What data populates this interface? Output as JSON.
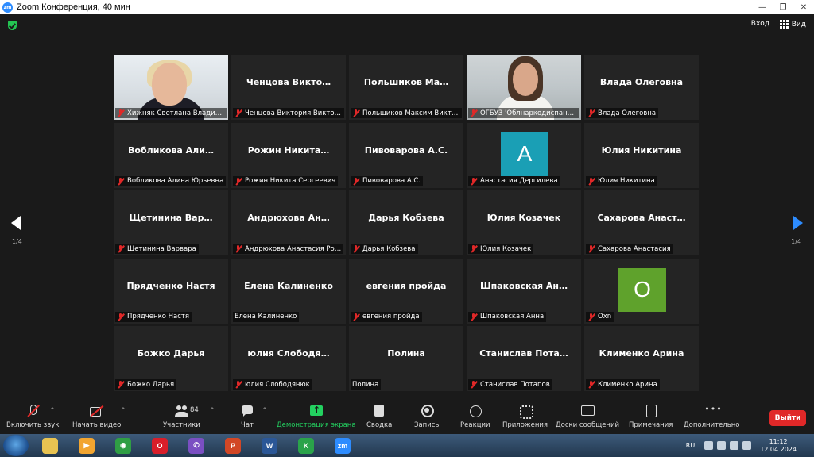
{
  "window": {
    "title": "Zoom Конференция, 40 мин",
    "app_icon": "zm"
  },
  "topbar": {
    "enter_label": "Вход",
    "view_label": "Вид"
  },
  "pagination": {
    "left": "1/4",
    "right": "1/4"
  },
  "tiles": [
    {
      "big": "",
      "label": "Хижняк Светлана Владими…",
      "video": 1,
      "muted": true
    },
    {
      "big": "Ченцова Виктo…",
      "label": "Ченцова Виктория Виктор…",
      "muted": true
    },
    {
      "big": "Польшиков Ма…",
      "label": "Польшиков Максим Викто…",
      "muted": true
    },
    {
      "big": "",
      "label": "ОГБУЗ 'Облнаркодиспансер'…",
      "video": 2,
      "muted": true,
      "active": true
    },
    {
      "big": "Влада Олеговна",
      "label": "Влада Олеговна",
      "muted": true
    },
    {
      "big": "Вобликова Али…",
      "label": "Вобликова Алина Юрьевна",
      "muted": true
    },
    {
      "big": "Рожин Никита…",
      "label": "Рожин Никита Сергеевич",
      "muted": true
    },
    {
      "big": "Пивоварова А.С.",
      "label": "Пивоварова А.С.",
      "muted": true
    },
    {
      "big": "",
      "label": "Анастасия Дергилева",
      "avatar": "A",
      "avatar_color": "#1a9fb5",
      "muted": true
    },
    {
      "big": "Юлия Никитина",
      "label": "Юлия Никитина",
      "muted": true
    },
    {
      "big": "Щетинина Вар…",
      "label": "Щетинина Варвара",
      "muted": true
    },
    {
      "big": "Андрюхова Ан…",
      "label": "Андрюхова Анастасия Ро…",
      "muted": true
    },
    {
      "big": "Дарья Кобзева",
      "label": "Дарья Кобзева",
      "muted": true
    },
    {
      "big": "Юлия Козачек",
      "label": "Юлия Козачек",
      "muted": true
    },
    {
      "big": "Сахарова Анаст…",
      "label": "Сахарова Анастасия",
      "muted": true
    },
    {
      "big": "Прядченко Настя",
      "label": "Прядченко Настя",
      "muted": true
    },
    {
      "big": "Елена Калиненко",
      "label": "Елена Калиненко",
      "muted": false
    },
    {
      "big": "евгения пройда",
      "label": "евгения пройда",
      "muted": true
    },
    {
      "big": "Шпаковская Ан…",
      "label": "Шпаковская Анна",
      "muted": true
    },
    {
      "big": "",
      "label": "Oxn",
      "avatar": "O",
      "avatar_color": "#5fa22c",
      "muted": true
    },
    {
      "big": "Божко Дарья",
      "label": "Божко Дарья",
      "muted": true
    },
    {
      "big": "юлия Слободя…",
      "label": "юлия Слободянюк",
      "muted": true
    },
    {
      "big": "Полина",
      "label": "Полина",
      "muted": false
    },
    {
      "big": "Станислав Пота…",
      "label": "Станислав Потапов",
      "muted": true
    },
    {
      "big": "Клименко Арина",
      "label": "Клименко Арина",
      "muted": true
    }
  ],
  "toolbar": {
    "audio": "Включить звук",
    "video": "Начать видео",
    "participants": "Участники",
    "participants_count": "84",
    "chat": "Чат",
    "share": "Демонстрация экрана",
    "summary": "Сводка",
    "record": "Запись",
    "reactions": "Реакции",
    "apps": "Приложения",
    "whiteboards": "Доски сообщений",
    "notes": "Примечания",
    "more": "Дополнительно",
    "exit": "Выйти"
  },
  "taskbar": {
    "lang": "RU",
    "time": "11:12",
    "date": "12.04.2024",
    "apps": [
      {
        "icon": "explorer-icon",
        "color": "#e8c352",
        "glyph": ""
      },
      {
        "icon": "media-player-icon",
        "color": "#f2a530",
        "glyph": "▶"
      },
      {
        "icon": "chrome-icon",
        "color": "#2f9e44",
        "glyph": "◉"
      },
      {
        "icon": "opera-icon",
        "color": "#d81e2a",
        "glyph": "O"
      },
      {
        "icon": "viber-icon",
        "color": "#7a4fc2",
        "glyph": "✆"
      },
      {
        "icon": "powerpoint-icon",
        "color": "#d24726",
        "glyph": "P"
      },
      {
        "icon": "word-icon",
        "color": "#2b5797",
        "glyph": "W"
      },
      {
        "icon": "k-app-icon",
        "color": "#2aa34a",
        "glyph": "K"
      },
      {
        "icon": "zoom-icon",
        "color": "#2d8cff",
        "glyph": "zm"
      }
    ]
  }
}
